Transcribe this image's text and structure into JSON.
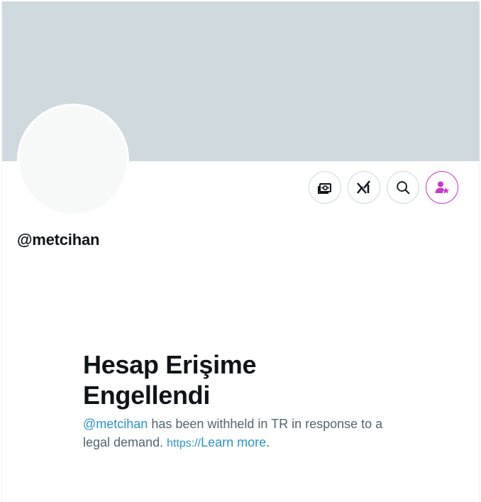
{
  "profile": {
    "handle": "@metcihan"
  },
  "actions": {
    "money_icon": "money-icon",
    "grok_icon": "grok-icon",
    "search_icon": "search-icon",
    "subscribe_icon": "user-star-icon"
  },
  "withheld": {
    "title": "Hesap Erişime Engellendi",
    "mention": "@metcihan",
    "message": " has been withheld in TR in response to a legal demand. ",
    "url_prefix": "https://",
    "learn_more": "Learn more",
    "period": "."
  },
  "colors": {
    "banner": "#cfd9de",
    "avatar": "#f7f9f9",
    "accent_link": "#2b93c9",
    "subscribe_accent": "#c936cc",
    "text_primary": "#0f1419",
    "text_secondary": "#536471"
  }
}
